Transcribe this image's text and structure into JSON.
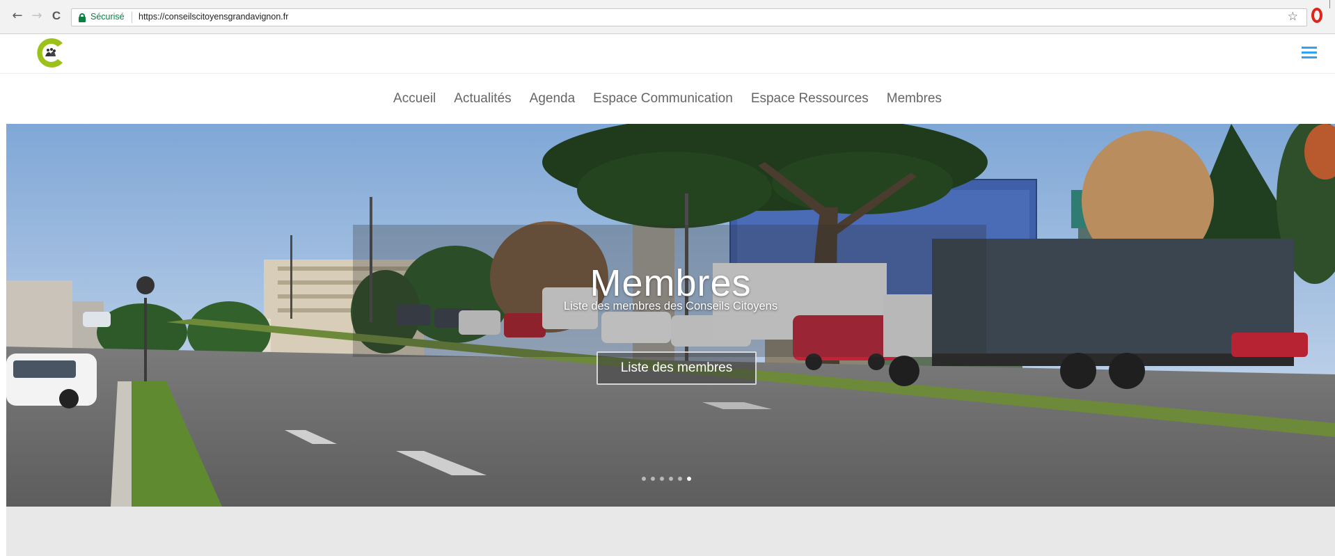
{
  "browser": {
    "back_icon": "←",
    "forward_icon": "→",
    "reload_icon": "C",
    "secure_label": "Sécurisé",
    "url": "https://conseilscitoyensgrandavignon.fr",
    "star_icon": "☆"
  },
  "site": {
    "logo_name": "conseils-citoyens-logo",
    "menu_icon": "hamburger-icon"
  },
  "nav": {
    "items": [
      {
        "label": "Accueil"
      },
      {
        "label": "Actualités"
      },
      {
        "label": "Agenda"
      },
      {
        "label": "Espace Communication"
      },
      {
        "label": "Espace Ressources"
      },
      {
        "label": "Membres"
      }
    ]
  },
  "hero": {
    "title": "Membres",
    "subtitle": "Liste des membres des Conseils Citoyens",
    "button_label": "Liste des membres",
    "slide_count": 6,
    "active_slide": 6
  },
  "colors": {
    "accent": "#2ea3f2",
    "logo_green": "#9cc21a",
    "secure_green": "#0b8043",
    "nav_text": "#666666"
  }
}
